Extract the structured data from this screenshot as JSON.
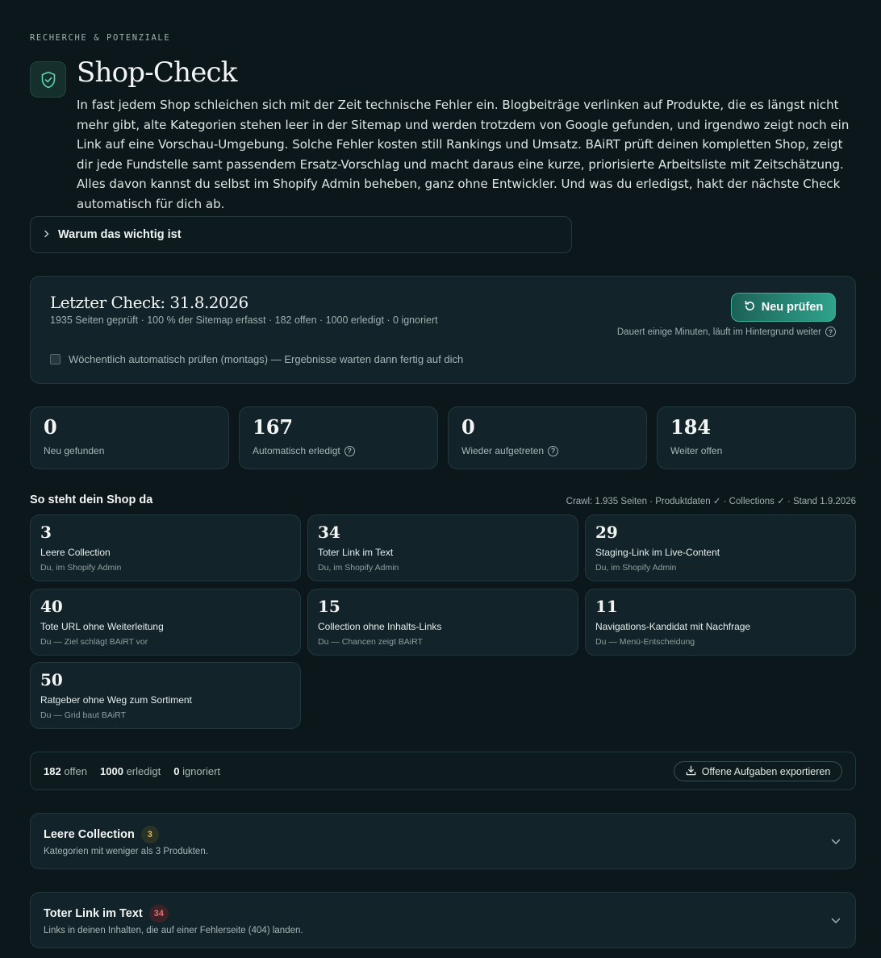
{
  "header": {
    "eyebrow": "RECHERCHE & POTENZIALE",
    "title": "Shop-Check",
    "icon": "shield-check-icon",
    "description": "In fast jedem Shop schleichen sich mit der Zeit technische Fehler ein. Blogbeiträge verlinken auf Produkte, die es längst nicht mehr gibt, alte Kategorien stehen leer in der Sitemap und werden trotzdem von Google gefunden, und irgendwo zeigt noch ein Link auf eine Vorschau-Umgebung. Solche Fehler kosten still Rankings und Umsatz. BAiRT prüft deinen kompletten Shop, zeigt dir jede Fundstelle samt passendem Ersatz-Vorschlag und macht daraus eine kurze, priorisierte Arbeitsliste mit Zeitschätzung. Alles davon kannst du selbst im Shopify Admin beheben, ganz ohne Entwickler. Und was du erledigst, hakt der nächste Check automatisch für dich ab."
  },
  "why": {
    "label": "Warum das wichtig ist"
  },
  "last_check": {
    "title": "Letzter Check: 31.8.2026",
    "subtitle": "1935 Seiten geprüft · 100 % der Sitemap erfasst · 182 offen · 1000 erledigt · 0 ignoriert",
    "button_label": "Neu prüfen",
    "note": "Dauert einige Minuten, läuft im Hintergrund weiter",
    "auto_label": "Wöchentlich automatisch prüfen (montags) — Ergebnisse warten dann fertig auf dich",
    "auto_checked": false
  },
  "stats": [
    {
      "value": "0",
      "label": "Neu gefunden",
      "help": false
    },
    {
      "value": "167",
      "label": "Automatisch erledigt",
      "help": true
    },
    {
      "value": "0",
      "label": "Wieder aufgetreten",
      "help": true
    },
    {
      "value": "184",
      "label": "Weiter offen",
      "help": false
    }
  ],
  "overview": {
    "title": "So steht dein Shop da",
    "meta": "Crawl: 1.935 Seiten · Produktdaten ✓ · Collections ✓ · Stand 1.9.2026",
    "categories": [
      {
        "value": "3",
        "label": "Leere Collection",
        "owner": "Du, im Shopify Admin"
      },
      {
        "value": "34",
        "label": "Toter Link im Text",
        "owner": "Du, im Shopify Admin"
      },
      {
        "value": "29",
        "label": "Staging-Link im Live-Content",
        "owner": "Du, im Shopify Admin"
      },
      {
        "value": "40",
        "label": "Tote URL ohne Weiterleitung",
        "owner": "Du — Ziel schlägt BAiRT vor"
      },
      {
        "value": "15",
        "label": "Collection ohne Inhalts-Links",
        "owner": "Du — Chancen zeigt BAiRT"
      },
      {
        "value": "11",
        "label": "Navigations-Kandidat mit Nachfrage",
        "owner": "Du — Menü-Entscheidung"
      },
      {
        "value": "50",
        "label": "Ratgeber ohne Weg zum Sortiment",
        "owner": "Du — Grid baut BAiRT"
      }
    ]
  },
  "summary": {
    "open_count": "182",
    "open_label": "offen",
    "done_count": "1000",
    "done_label": "erledigt",
    "ignored_count": "0",
    "ignored_label": "ignoriert",
    "export_label": "Offene Aufgaben exportieren"
  },
  "groups": [
    {
      "name": "Leere Collection",
      "count": "3",
      "description": "Kategorien mit weniger als 3 Produkten.",
      "badge_color": "#e3b64a"
    },
    {
      "name": "Toter Link im Text",
      "count": "34",
      "description": "Links in deinen Inhalten, die auf einer Fehlerseite (404) landen.",
      "badge_color": "#f06a6a"
    }
  ]
}
